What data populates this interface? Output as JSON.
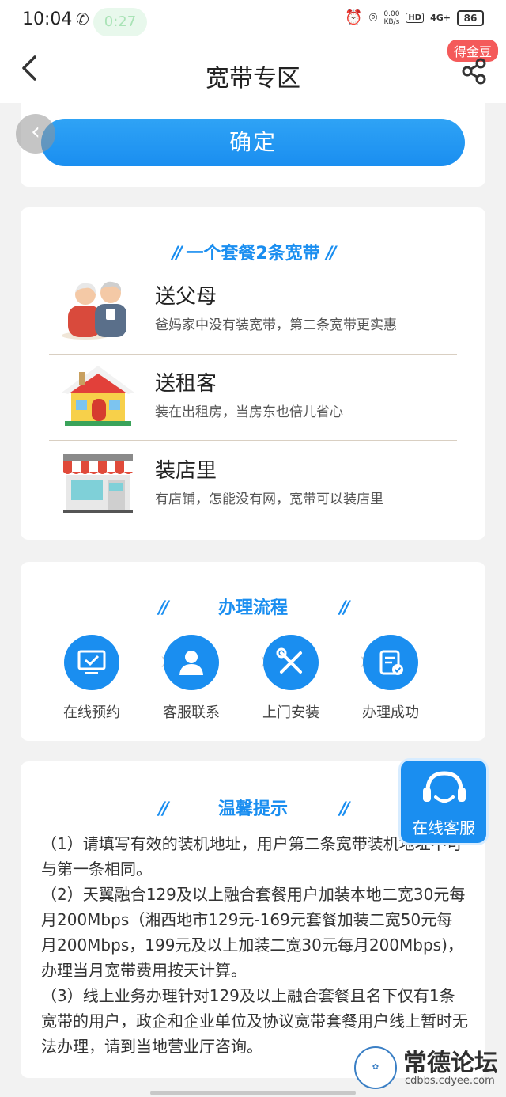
{
  "status_bar": {
    "time": "10:04",
    "pill_text": "0:27",
    "speed_top": "0.00",
    "speed_bottom": "KB/s",
    "hd": "HD",
    "network": "4G+",
    "battery": "86"
  },
  "header": {
    "title": "宽带专区",
    "badge": "得金豆",
    "back_icon": "chevron-left-icon",
    "share_icon": "share-icon"
  },
  "confirm": {
    "label": "确定"
  },
  "float_back": "‹",
  "promo": {
    "title": "一个套餐2条宽带",
    "items": [
      {
        "title": "送父母",
        "desc": "爸妈家中没有装宽带，第二条宽带更实惠",
        "icon": "elderly-couple-icon"
      },
      {
        "title": "送租客",
        "desc": "装在出租房，当房东也倍儿省心",
        "icon": "house-icon"
      },
      {
        "title": "装店里",
        "desc": "有店铺，怎能没有网，宽带可以装店里",
        "icon": "shop-icon"
      }
    ]
  },
  "process": {
    "title": "办理流程",
    "steps": [
      {
        "label": "在线预约",
        "icon": "monitor-check-icon"
      },
      {
        "label": "客服联系",
        "icon": "person-icon"
      },
      {
        "label": "上门安装",
        "icon": "tools-icon"
      },
      {
        "label": "办理成功",
        "icon": "clipboard-check-icon"
      }
    ]
  },
  "tips": {
    "title": "温馨提示",
    "lines": [
      "（1）请填写有效的装机地址，用户第二条宽带装机地址不可与第一条相同。",
      "（2）天翼融合129及以上融合套餐用户加装本地二宽30元每月200Mbps（湘西地市129元-169元套餐加装二宽50元每月200Mbps，199元及以上加装二宽30元每月200Mbps)，办理当月宽带费用按天计算。",
      "（3）线上业务办理针对129及以上融合套餐且名下仅有1条宽带的用户，政企和企业单位及协议宽带套餐用户线上暂时无法办理，请到当地营业厅咨询。"
    ]
  },
  "service": {
    "label": "在线客服",
    "icon": "headset-icon"
  },
  "watermark": {
    "text": "常德论坛",
    "url": "cdbbs.cdyee.com"
  },
  "colors": {
    "accent": "#1a8ef0",
    "badge": "#f45a5a"
  }
}
